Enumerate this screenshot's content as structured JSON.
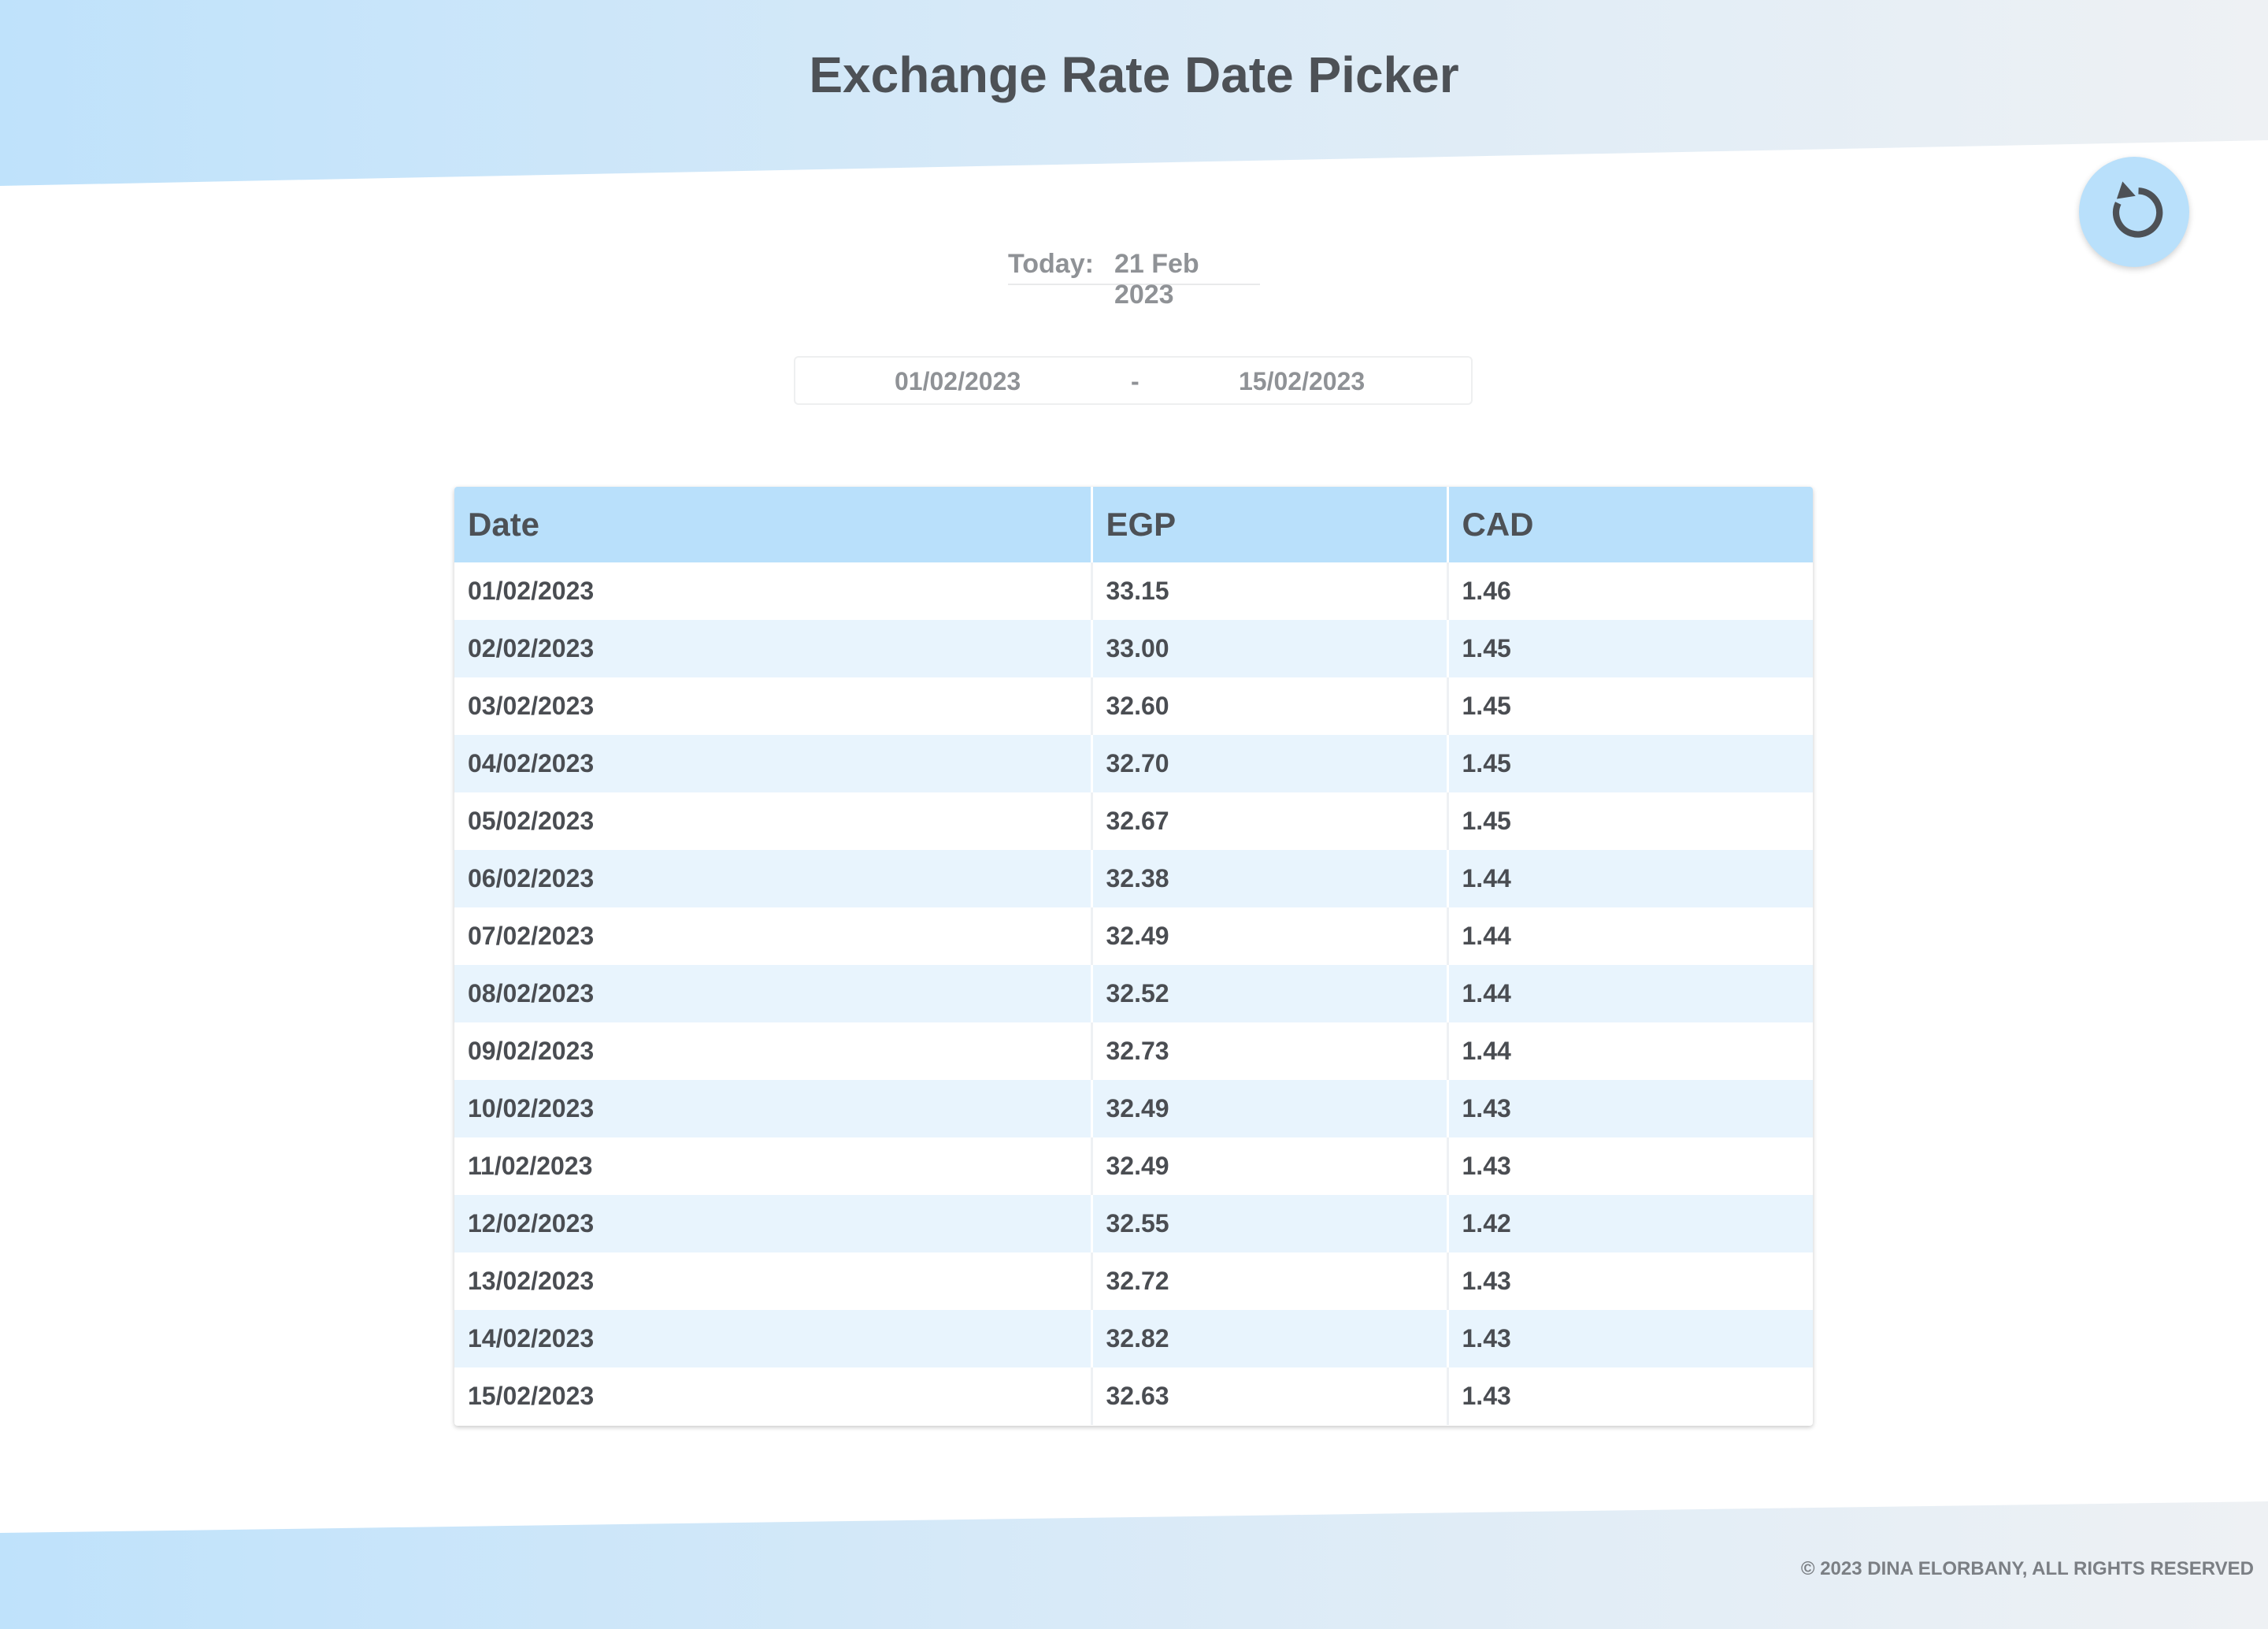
{
  "header": {
    "title": "Exchange Rate Date Picker",
    "refresh_icon": "refresh-icon"
  },
  "today": {
    "label": "Today:",
    "value": "21 Feb 2023"
  },
  "date_range": {
    "start": "01/02/2023",
    "separator": "-",
    "end": "15/02/2023"
  },
  "table": {
    "columns": [
      "Date",
      "EGP",
      "CAD"
    ],
    "rows": [
      [
        "01/02/2023",
        "33.15",
        "1.46"
      ],
      [
        "02/02/2023",
        "33.00",
        "1.45"
      ],
      [
        "03/02/2023",
        "32.60",
        "1.45"
      ],
      [
        "04/02/2023",
        "32.70",
        "1.45"
      ],
      [
        "05/02/2023",
        "32.67",
        "1.45"
      ],
      [
        "06/02/2023",
        "32.38",
        "1.44"
      ],
      [
        "07/02/2023",
        "32.49",
        "1.44"
      ],
      [
        "08/02/2023",
        "32.52",
        "1.44"
      ],
      [
        "09/02/2023",
        "32.73",
        "1.44"
      ],
      [
        "10/02/2023",
        "32.49",
        "1.43"
      ],
      [
        "11/02/2023",
        "32.49",
        "1.43"
      ],
      [
        "12/02/2023",
        "32.55",
        "1.42"
      ],
      [
        "13/02/2023",
        "32.72",
        "1.43"
      ],
      [
        "14/02/2023",
        "32.82",
        "1.43"
      ],
      [
        "15/02/2023",
        "32.63",
        "1.43"
      ]
    ]
  },
  "footer": {
    "copyright": "© 2023 DINA ELORBANY, ALL RIGHTS RESERVED"
  },
  "colors": {
    "accent": "#b9e0fb",
    "stripe": "#e8f4fd",
    "text": "#4a4d52",
    "muted": "#8f9296"
  }
}
